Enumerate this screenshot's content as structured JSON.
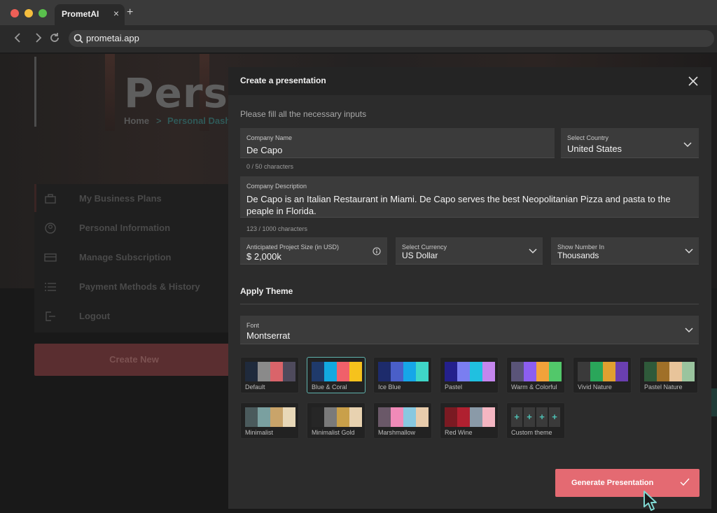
{
  "browser": {
    "tab_title": "PrometAI",
    "tab_close": "×",
    "new_tab": "+",
    "url": "prometai.app"
  },
  "background_page": {
    "hero_title": "Perso",
    "breadcrumb": {
      "home": "Home",
      "separator": ">",
      "current": "Personal Dashb"
    },
    "menu": [
      {
        "label": "My Business Plans",
        "icon": "briefcase-icon"
      },
      {
        "label": "Personal Information",
        "icon": "user-icon"
      },
      {
        "label": "Manage Subscription",
        "icon": "card-icon"
      },
      {
        "label": "Payment Methods & History",
        "icon": "list-icon"
      },
      {
        "label": "Logout",
        "icon": "logout-icon"
      }
    ],
    "create_new": "Create New"
  },
  "modal": {
    "title": "Create a presentation",
    "subtitle": "Please fill all the necessary inputs",
    "company_name": {
      "label": "Company Name",
      "value": "De Capo",
      "counter": "0 / 50 characters"
    },
    "country": {
      "label": "Select Country",
      "value": "United States"
    },
    "description": {
      "label": "Company Description",
      "value": "De Capo is an Italian Restaurant in Miami. De Capo serves the best Neopolitanian Pizza and pasta to the peaple in Florida.",
      "counter": "123 / 1000 characters"
    },
    "project_size": {
      "label": "Anticipated Project Size (in USD)",
      "value": "$ 2,000k"
    },
    "currency": {
      "label": "Select Currency",
      "value": "US Dollar"
    },
    "number_in": {
      "label": "Show Number In",
      "value": "Thousands"
    },
    "theme_section": "Apply Theme",
    "font": {
      "label": "Font",
      "value": "Montserrat"
    },
    "themes": [
      {
        "name": "Default",
        "colors": [
          "#1f2a3c",
          "#8a8a8a",
          "#d9646a",
          "#4e4a5c"
        ]
      },
      {
        "name": "Blue & Coral",
        "colors": [
          "#1f3a6b",
          "#12a8e0",
          "#f0606a",
          "#f6c21c"
        ],
        "selected": true
      },
      {
        "name": "Ice Blue",
        "colors": [
          "#1d2b6b",
          "#4a5fc8",
          "#16a6e8",
          "#3fd6c8"
        ]
      },
      {
        "name": "Pastel",
        "colors": [
          "#24208c",
          "#7a7ef0",
          "#20c0e0",
          "#c486ee"
        ]
      },
      {
        "name": "Warm & Colorful",
        "colors": [
          "#5a5478",
          "#8c5ef0",
          "#f2a23a",
          "#52c86a"
        ]
      },
      {
        "name": "Vivid Nature",
        "colors": [
          "#3a3a3a",
          "#2aa65a",
          "#e0a030",
          "#6a3fb0"
        ]
      },
      {
        "name": "Pastel Nature",
        "colors": [
          "#2f5a3a",
          "#a07028",
          "#e8c49a",
          "#9ac49e"
        ]
      },
      {
        "name": "Minimalist",
        "colors": [
          "#4a5a5c",
          "#7aa0a0",
          "#c9a46a",
          "#e8d8b8"
        ]
      },
      {
        "name": "Minimalist Gold",
        "colors": [
          "#262626",
          "#7a7a7a",
          "#c9a04a",
          "#e8d2b0"
        ]
      },
      {
        "name": "Marshmallow",
        "colors": [
          "#6a5868",
          "#f08ab8",
          "#88c8e0",
          "#e8ccac"
        ]
      },
      {
        "name": "Red Wine",
        "colors": [
          "#7a1a22",
          "#b02030",
          "#8a9aa8",
          "#f4b6c2"
        ]
      },
      {
        "name": "Custom theme",
        "plus": [
          "+",
          "+",
          "+",
          "+"
        ]
      }
    ],
    "generate_button": "Generate Presentation"
  },
  "colors": {
    "accent": "#e46a72",
    "teal": "#5fb3ad"
  }
}
